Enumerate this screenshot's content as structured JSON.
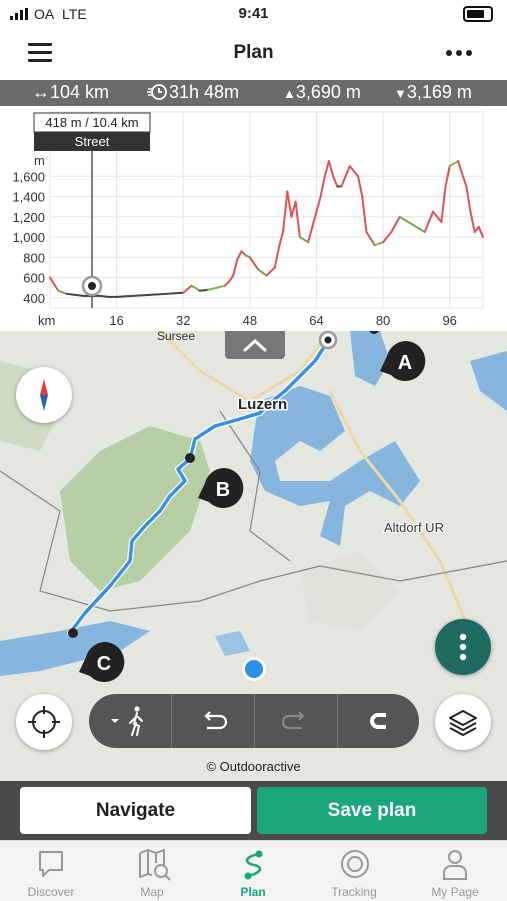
{
  "status": {
    "carrier": "OA",
    "network": "LTE",
    "time": "9:41"
  },
  "header": {
    "title": "Plan"
  },
  "stats": {
    "distance": "104 km",
    "duration": "31h 48m",
    "ascent": "3,690 m",
    "descent": "3,169 m"
  },
  "chart": {
    "tooltip_value": "418 m / 10.4 km",
    "tooltip_surface": "Street",
    "y_unit": "m",
    "x_unit": "km",
    "y_ticks": [
      "1,600",
      "1,400",
      "1,200",
      "1,000",
      "800",
      "600",
      "400"
    ],
    "x_ticks": [
      "16",
      "32",
      "48",
      "64",
      "80",
      "96"
    ]
  },
  "chart_data": {
    "type": "line",
    "xlabel": "km",
    "ylabel": "m",
    "xlim": [
      0,
      104
    ],
    "ylim": [
      300,
      1800
    ],
    "x": [
      0,
      2,
      4,
      6,
      8,
      10.4,
      12,
      14,
      16,
      20,
      24,
      28,
      30,
      32,
      34,
      36,
      38,
      40,
      42,
      43,
      44,
      45,
      46,
      47,
      48,
      50,
      52,
      54,
      55,
      56,
      57,
      58,
      59,
      60,
      62,
      63,
      64,
      65,
      66,
      67,
      68,
      69,
      70,
      72,
      74,
      75,
      76,
      78,
      80,
      82,
      84,
      86,
      88,
      90,
      92,
      94,
      95,
      96,
      98,
      100,
      101,
      102,
      103,
      104
    ],
    "y": [
      600,
      470,
      440,
      430,
      420,
      418,
      420,
      410,
      410,
      420,
      430,
      440,
      445,
      450,
      520,
      470,
      480,
      500,
      520,
      560,
      620,
      780,
      860,
      820,
      800,
      680,
      620,
      700,
      900,
      1060,
      1450,
      1200,
      1350,
      1000,
      950,
      1100,
      1250,
      1400,
      1600,
      1750,
      1600,
      1500,
      1500,
      1700,
      1600,
      1400,
      1050,
      920,
      950,
      1050,
      1200,
      1150,
      1100,
      1050,
      1250,
      1150,
      1500,
      1700,
      1750,
      1500,
      1250,
      1050,
      1100,
      1000
    ]
  },
  "map": {
    "labels": {
      "sursee": "Sursee",
      "luzern": "Luzern",
      "altdorf": "Altdorf UR"
    },
    "markers": {
      "a": "A",
      "b": "B",
      "c": "C"
    },
    "attribution": "© Outdooractive"
  },
  "actions": {
    "navigate": "Navigate",
    "save": "Save plan"
  },
  "tabs": [
    "Discover",
    "Map",
    "Plan",
    "Tracking",
    "My Page"
  ],
  "colors": {
    "accent": "#1aa57c",
    "fab": "#1f6b5f",
    "route": "#3b8fe0",
    "stats_bar": "#6b6b6b"
  }
}
